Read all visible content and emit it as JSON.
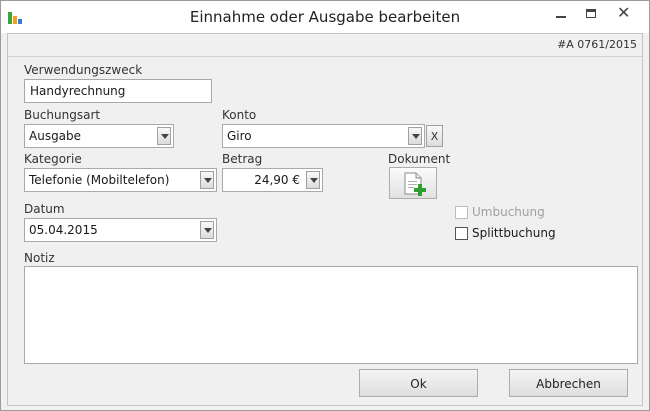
{
  "window": {
    "title": "Einnahme oder Ausgabe bearbeiten",
    "minimize_glyph": "—",
    "maximize_glyph": "☐",
    "close_glyph": "✕"
  },
  "header": {
    "reference": "#A 0761/2015"
  },
  "form": {
    "verwendungszweck": {
      "label": "Verwendungszweck",
      "value": "Handyrechnung"
    },
    "buchungsart": {
      "label": "Buchungsart",
      "value": "Ausgabe"
    },
    "konto": {
      "label": "Konto",
      "value": "Giro",
      "clear_label": "X"
    },
    "kategorie": {
      "label": "Kategorie",
      "value": "Telefonie (Mobiltelefon)"
    },
    "betrag": {
      "label": "Betrag",
      "value": "24,90 €"
    },
    "dokument": {
      "label": "Dokument",
      "icon": "add-document-icon"
    },
    "datum": {
      "label": "Datum",
      "value": "05.04.2015"
    },
    "umbuchung": {
      "label": "Umbuchung",
      "checked": false,
      "enabled": false
    },
    "splittbuchung": {
      "label": "Splittbuchung",
      "checked": false,
      "enabled": true
    },
    "notiz": {
      "label": "Notiz",
      "value": ""
    }
  },
  "buttons": {
    "ok": "Ok",
    "cancel": "Abbrechen"
  },
  "colors": {
    "add_green": "#2e9e2e",
    "app_icon_green": "#3aa53a",
    "app_icon_orange": "#f0a020",
    "app_icon_blue": "#3a7ad0"
  }
}
